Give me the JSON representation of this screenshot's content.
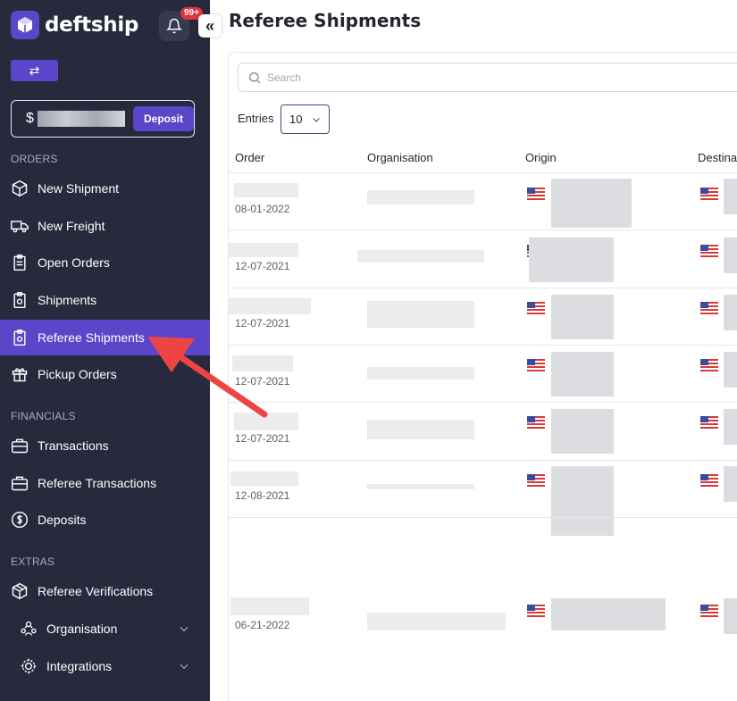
{
  "app": {
    "name": "deftship",
    "notification_count": "99+"
  },
  "sidebar": {
    "balance_prefix": "$",
    "deposit_label": "Deposit",
    "sections": {
      "orders": "ORDERS",
      "financials": "FINANCIALS",
      "extras": "EXTRAS"
    },
    "items": [
      {
        "label": "New Shipment",
        "icon": "box-icon"
      },
      {
        "label": "New Freight",
        "icon": "truck-icon"
      },
      {
        "label": "Open Orders",
        "icon": "clipboard-icon"
      },
      {
        "label": "Shipments",
        "icon": "clipboard-check-icon"
      },
      {
        "label": "Referee Shipments",
        "icon": "clipboard-check-icon",
        "active": true
      },
      {
        "label": "Pickup Orders",
        "icon": "gift-box-icon"
      },
      {
        "label": "Transactions",
        "icon": "briefcase-icon"
      },
      {
        "label": "Referee Transactions",
        "icon": "briefcase-icon"
      },
      {
        "label": "Deposits",
        "icon": "dollar-icon"
      },
      {
        "label": "Referee Verifications",
        "icon": "package-check-icon"
      },
      {
        "label": "Organisation",
        "icon": "users-icon"
      },
      {
        "label": "Integrations",
        "icon": "puzzle-icon"
      }
    ]
  },
  "main": {
    "title": "Referee Shipments",
    "search_placeholder": "Search",
    "entries_label": "Entries",
    "entries_value": "10",
    "columns": [
      "Order",
      "Organisation",
      "Origin",
      "Destina"
    ],
    "rows": [
      {
        "date": "08-01-2022"
      },
      {
        "date": "12-07-2021"
      },
      {
        "date": "12-07-2021"
      },
      {
        "date": "12-07-2021"
      },
      {
        "date": "12-07-2021"
      },
      {
        "date": "12-08-2021"
      },
      {
        "date": "06-21-2022"
      }
    ]
  },
  "colors": {
    "sidebar_bg": "#262a3c",
    "accent": "#5b45c9",
    "badge": "#e2353f",
    "arrow": "#ef4444"
  }
}
